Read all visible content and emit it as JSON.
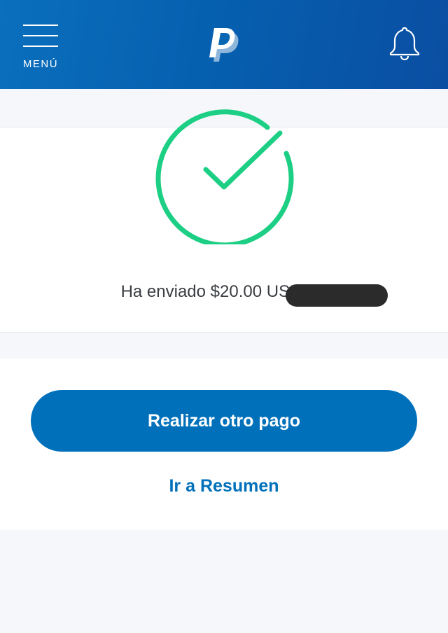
{
  "header": {
    "menu_label": "MENÚ",
    "menu_icon": "hamburger-menu-icon",
    "logo_icon": "paypal-logo-icon",
    "notifications_icon": "bell-icon"
  },
  "confirmation": {
    "status_icon": "success-check-icon",
    "message": "Ha enviado $20.00 USD"
  },
  "actions": {
    "primary_label": "Realizar otro pago",
    "secondary_label": "Ir a Resumen"
  },
  "colors": {
    "header_start": "#0a6fbd",
    "header_end": "#0a4ea2",
    "primary": "#0070ba",
    "success": "#1ccf84"
  }
}
